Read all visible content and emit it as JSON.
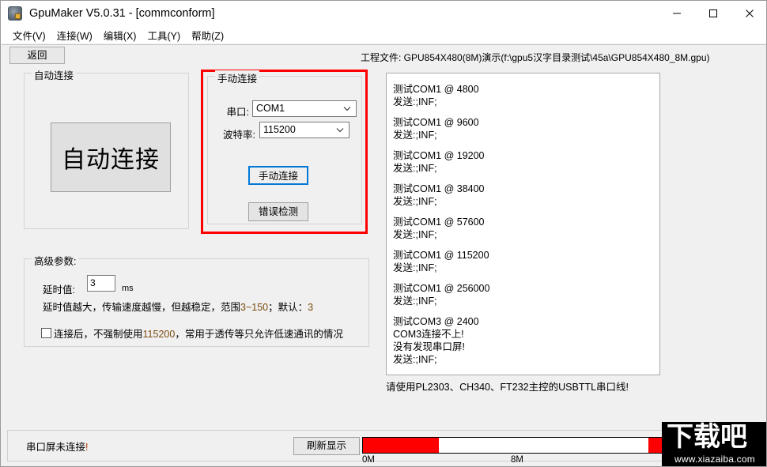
{
  "window": {
    "title": "GpuMaker V5.0.31 - [commconform]",
    "icon": "app-icon",
    "controls": {
      "minimize": "minimize-icon",
      "maximize": "maximize-icon",
      "close": "close-icon"
    }
  },
  "menubar": {
    "items": [
      {
        "label": "文件(V)"
      },
      {
        "label": "连接(W)"
      },
      {
        "label": "编辑(X)"
      },
      {
        "label": "工具(Y)"
      },
      {
        "label": "帮助(Z)"
      }
    ]
  },
  "toolbar": {
    "back_label": "返回",
    "project_file": "工程文件: GPU854X480(8M)演示(f:\\gpu5汉字目录测试\\45a\\GPU854X480_8M.gpu)"
  },
  "auto_connect": {
    "group_title": "自动连接",
    "button_label": "自动连接"
  },
  "manual_connect": {
    "group_title": "手动连接",
    "highlight_color": "#ff0000",
    "port": {
      "label": "串口:",
      "value": "COM1",
      "chevron": "chevron-down-icon"
    },
    "baud": {
      "label": "波特率:",
      "value": "115200",
      "chevron": "chevron-down-icon"
    },
    "connect_button": "手动连接",
    "connect_button_focus_color": "#0078d7",
    "error_button": "错误检测"
  },
  "advanced": {
    "group_title": "高级参数:",
    "delay_label": "延时值:",
    "delay_value": "3",
    "delay_unit": "ms",
    "hint_prefix": "延时值越大，传输速度越慢，但越稳定，范围",
    "hint_range": "3~150",
    "hint_mid": "；默认：",
    "hint_default": "3",
    "checkbox_checked": false,
    "checkbox_prefix": "连接后，不强制使用",
    "checkbox_num": "115200",
    "checkbox_suffix": "，常用于透传等只允许低速通讯的情况"
  },
  "log": {
    "lines": [
      "测试COM1 @ 4800",
      "发送:;INF;",
      "",
      "测试COM1 @ 9600",
      "发送:;INF;",
      "",
      "测试COM1 @ 19200",
      "发送:;INF;",
      "",
      "测试COM1 @ 38400",
      "发送:;INF;",
      "",
      "测试COM1 @ 57600",
      "发送:;INF;",
      "",
      "测试COM1 @ 115200",
      "发送:;INF;",
      "",
      "测试COM1 @ 256000",
      "发送:;INF;",
      "",
      "测试COM3 @ 2400",
      "COM3连接不上!",
      "没有发现串口屏!",
      "发送:;INF;"
    ],
    "note": "请使用PL2303、CH340、FT232主控的USBTTL串口线!"
  },
  "statusbar": {
    "status_text": "串口屏未连接",
    "status_bang": "!",
    "refresh_label": "刷新显示",
    "progress": {
      "left_percent": 25,
      "right_percent": 6,
      "fill_color": "#ff0000",
      "scale_start": "0M",
      "scale_end": "8M"
    }
  },
  "watermark": {
    "cn": "下载吧",
    "url": "www.xiazaiba.com"
  }
}
